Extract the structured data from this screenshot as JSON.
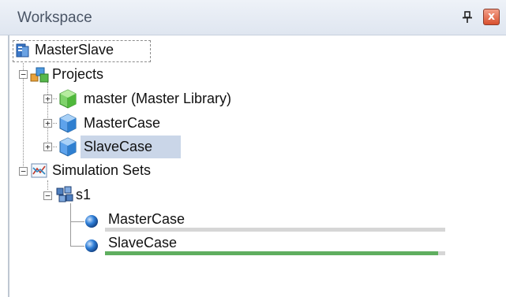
{
  "panel": {
    "title": "Workspace",
    "pin_glyph": "⊥",
    "close_glyph": "x"
  },
  "tree": {
    "root": {
      "label": "MasterSlave",
      "icon": "workspace-icon"
    },
    "projects": {
      "label": "Projects",
      "icon": "projects-icon",
      "expander": "−",
      "items": [
        {
          "label": "master (Master Library)",
          "icon": "library-cube-icon",
          "expander": "+"
        },
        {
          "label": "MasterCase",
          "icon": "case-cube-icon",
          "expander": "+"
        },
        {
          "label": "SlaveCase",
          "icon": "case-cube-icon",
          "expander": "+",
          "selected": true
        }
      ]
    },
    "simulation_sets": {
      "label": "Simulation Sets",
      "icon": "simulation-sets-icon",
      "expander": "−",
      "set": {
        "label": "s1",
        "icon": "simulation-set-icon",
        "expander": "−",
        "runs": [
          {
            "label": "MasterCase",
            "icon": "run-ball-icon",
            "progress": 0
          },
          {
            "label": "SlaveCase",
            "icon": "run-ball-icon",
            "progress": 0.98
          }
        ]
      }
    }
  },
  "colors": {
    "progress_fill": "#5fae5f",
    "progress_track": "#d6d6d6",
    "selection": "#cad6e8"
  }
}
